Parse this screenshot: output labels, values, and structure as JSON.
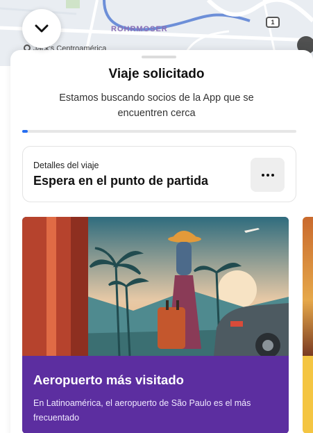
{
  "map": {
    "area_label": "ROHRMOSER",
    "poi_label": "Jack's Centroamérica",
    "route_number": "1",
    "collapse_icon": "chevron-down-icon"
  },
  "sheet": {
    "title": "Viaje solicitado",
    "subtitle": "Estamos buscando socios de la App que se encuentren cerca",
    "progress_fraction": 0.02
  },
  "details": {
    "label": "Detalles del viaje",
    "value": "Espera en el punto de partida",
    "more_icon": "more-horizontal-icon"
  },
  "promo": {
    "title": "Aeropuerto más visitado",
    "text": "En Latinoamérica, el aeropuerto de São Paulo es el más frecuentado"
  },
  "colors": {
    "accent_blue": "#276ef1",
    "promo_purple": "#5c2ea0"
  }
}
